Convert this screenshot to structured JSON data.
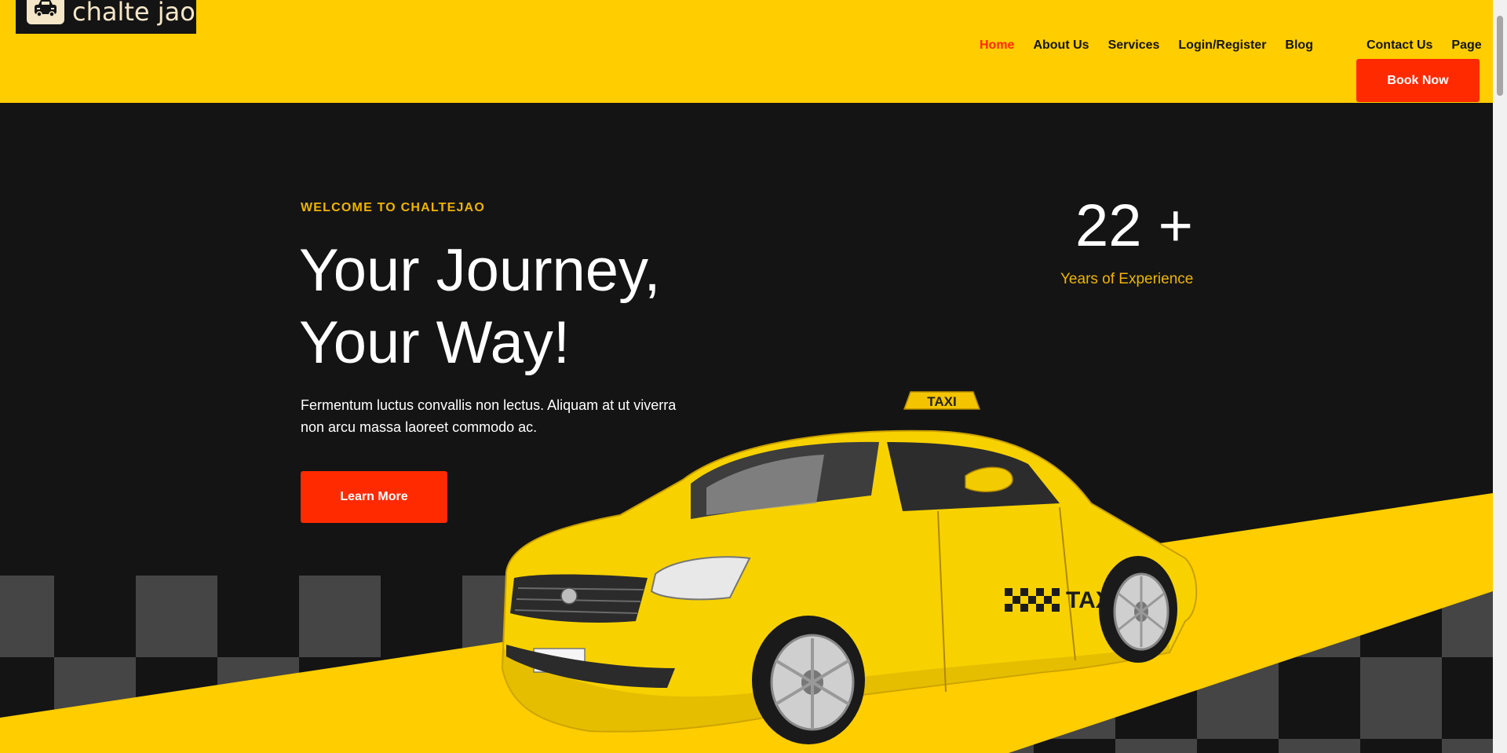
{
  "brand": {
    "name": "chalte jao"
  },
  "nav": {
    "items": [
      "Home",
      "About Us",
      "Services",
      "Login/Register",
      "Blog",
      "Contact Us",
      "Page"
    ],
    "active": "Home",
    "book_label": "Book Now"
  },
  "hero": {
    "eyebrow": "WELCOME TO CHALTEJAO",
    "title_line1": "Your Journey,",
    "title_line2": "Your Way!",
    "description_line1": "Fermentum luctus convallis non lectus. Aliquam at ut viverra",
    "description_line2": "non arcu massa laoreet commodo ac.",
    "cta_label": "Learn More",
    "stat_value": "22 +",
    "stat_label": "Years of Experience",
    "taxi_sign": "TAXI",
    "taxi_door_text": "TAXI"
  },
  "colors": {
    "header_bg": "#ffcd00",
    "hero_bg": "#141414",
    "accent_red": "#ff2a00",
    "accent_gold": "#f0b400",
    "active_nav": "#ff2a00"
  },
  "icons": {
    "logo": "taxi-car-icon"
  }
}
